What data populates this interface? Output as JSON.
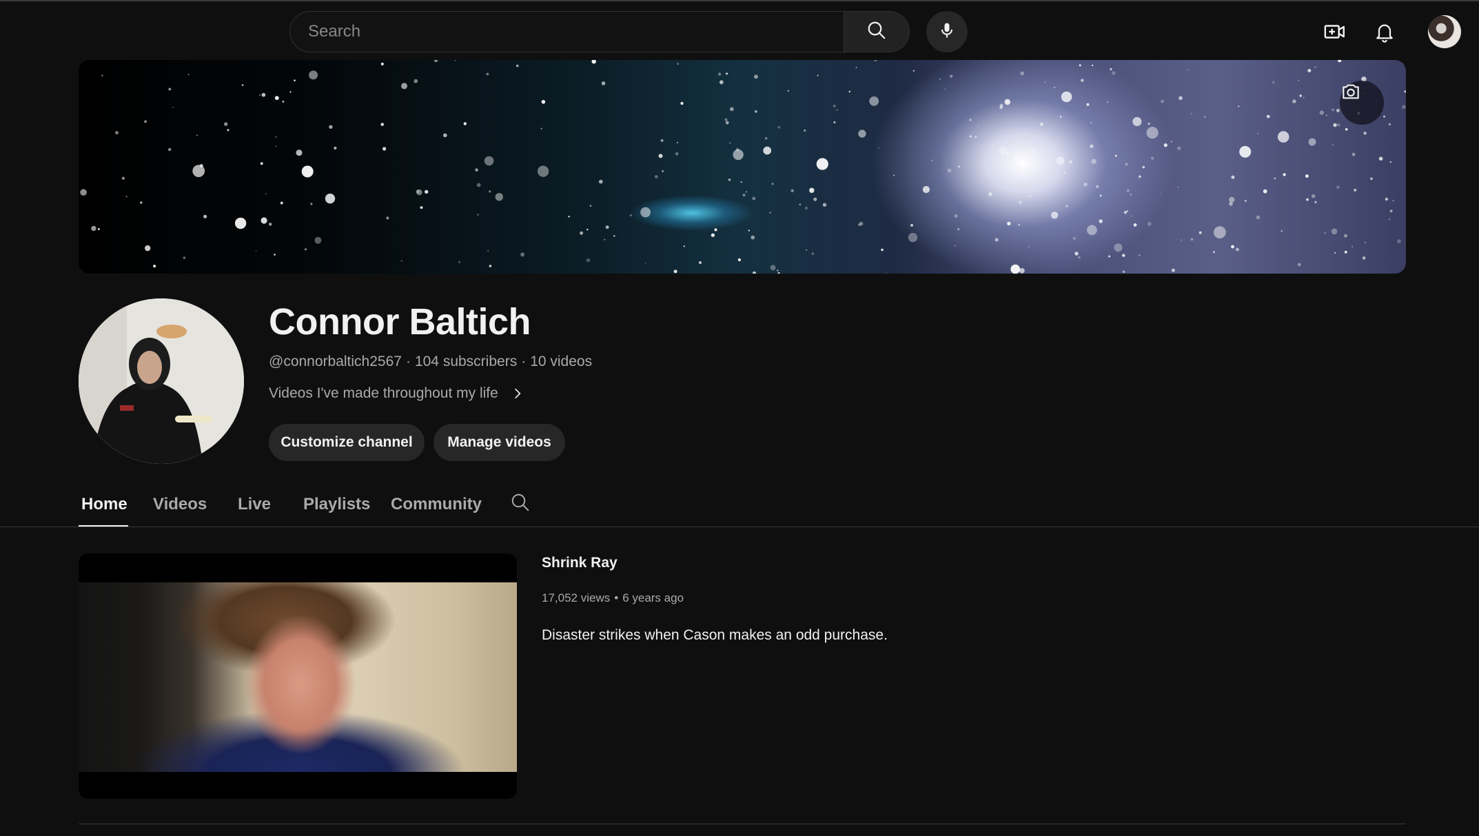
{
  "masthead": {
    "search_placeholder": "Search",
    "icons": [
      "search-icon",
      "microphone-icon",
      "create-video-icon",
      "notifications-bell-icon",
      "account-avatar"
    ]
  },
  "banner": {
    "camera_icon": "camera-icon"
  },
  "channel": {
    "name": "Connor Baltich",
    "handle": "@connorbaltich2567",
    "subscribers": "104 subscribers",
    "videos": "10 videos",
    "meta_separator": "·",
    "description": "Videos I've made throughout my life",
    "buttons": {
      "customize": "Customize channel",
      "manage": "Manage videos"
    }
  },
  "tabs": [
    {
      "label": "Home",
      "active": true
    },
    {
      "label": "Videos",
      "active": false
    },
    {
      "label": "Live",
      "active": false
    },
    {
      "label": "Playlists",
      "active": false
    },
    {
      "label": "Community",
      "active": false
    }
  ],
  "featured_video": {
    "title": "Shrink Ray",
    "views": "17,052 views",
    "age": "6 years ago",
    "separator": "•",
    "description": "Disaster strikes when Cason makes an odd purchase."
  },
  "colors": {
    "background": "#0f0f0f",
    "text_primary": "#f1f1f1",
    "text_secondary": "#aaaaaa",
    "button_bg": "#272727"
  }
}
